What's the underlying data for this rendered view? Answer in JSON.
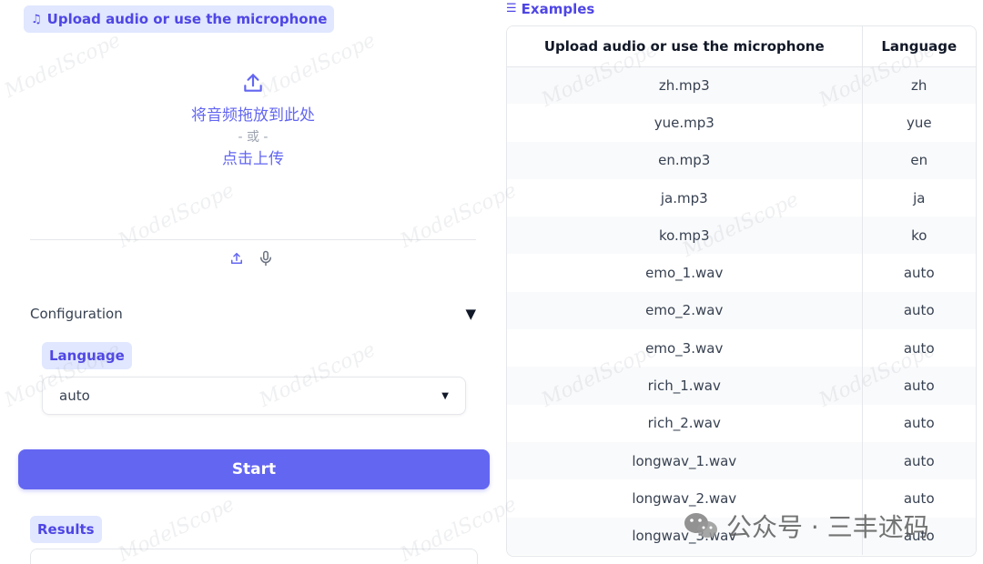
{
  "upload": {
    "label": "Upload audio or use the microphone",
    "drop_text": "将音频拖放到此处",
    "or_text": "- 或 -",
    "click_text": "点击上传"
  },
  "config": {
    "title": "Configuration",
    "language_label": "Language",
    "language_value": "auto"
  },
  "start_label": "Start",
  "results_label": "Results",
  "examples": {
    "label": "Examples",
    "headers": [
      "Upload audio or use the microphone",
      "Language"
    ],
    "rows": [
      [
        "zh.mp3",
        "zh"
      ],
      [
        "yue.mp3",
        "yue"
      ],
      [
        "en.mp3",
        "en"
      ],
      [
        "ja.mp3",
        "ja"
      ],
      [
        "ko.mp3",
        "ko"
      ],
      [
        "emo_1.wav",
        "auto"
      ],
      [
        "emo_2.wav",
        "auto"
      ],
      [
        "emo_3.wav",
        "auto"
      ],
      [
        "rich_1.wav",
        "auto"
      ],
      [
        "rich_2.wav",
        "auto"
      ],
      [
        "longwav_1.wav",
        "auto"
      ],
      [
        "longwav_2.wav",
        "auto"
      ],
      [
        "longwav_3.wav",
        "auto"
      ]
    ]
  },
  "watermark": "ModelScope",
  "overlay_text": "公众号 · 三丰述码",
  "colors": {
    "accent": "#6366f1",
    "pill_bg": "#e0e7ff",
    "pill_text": "#4f46e5"
  }
}
